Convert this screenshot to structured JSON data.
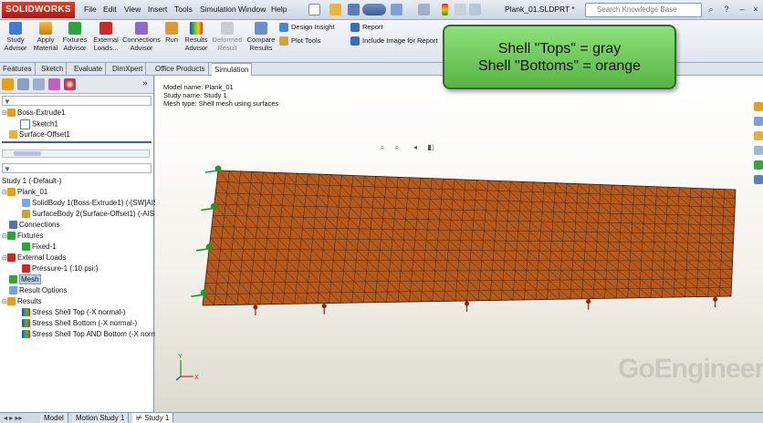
{
  "app": {
    "logo_text": "SOLIDWORKS",
    "document_title": "Plank_01.SLDPRT *"
  },
  "menu": [
    "File",
    "Edit",
    "View",
    "Insert",
    "Tools",
    "Simulation",
    "Window",
    "Help"
  ],
  "search": {
    "placeholder": "Search Knowledge Base"
  },
  "ribbon": {
    "study_advisor": "Study\nAdvisor",
    "apply_material": "Apply\nMaterial",
    "fixtures_advisor": "Fixtures\nAdvisor",
    "external_loads": "External\nLoads...",
    "connections_advisor": "Connections\nAdvisor",
    "run": "Run",
    "results_advisor": "Results\nAdvisor",
    "deformed_result": "Deformed\nResult",
    "compare_results": "Compare\nResults",
    "design_insight": "Design Insight",
    "plot_tools": "Plot Tools",
    "report": "Report",
    "include_image": "Include Image for Report"
  },
  "command_tabs": [
    "Features",
    "Sketch",
    "Evaluate",
    "DimXpert",
    "Office Products",
    "Simulation"
  ],
  "feature_tree": {
    "items": [
      "Boss-Extrude1",
      "Sketch1",
      "Surface-Offset1"
    ]
  },
  "study_tree": {
    "root": "Study 1 (-Default-)",
    "part": "Plank_01",
    "solid_body": "SolidBody 1(Boss-Extrude1) (-[SW]AIS",
    "surface_body": "SurfaceBody 2(Surface-Offset1) (-AISI",
    "connections": "Connections",
    "fixtures": "Fixtures",
    "fixed": "Fixed-1",
    "external_loads": "External Loads",
    "pressure": "Pressure-1 (:10 psi:)",
    "mesh": "Mesh",
    "result_options": "Result Options",
    "results": "Results",
    "result_1": "Stress Shell Top (-X normal-)",
    "result_2": "Stress Shell Bottom (-X normal-)",
    "result_3": "Stress Shell Top AND Bottom (-X norm"
  },
  "viewport": {
    "model_name": "Model name: Plank_01",
    "study_name": "Study name: Study 1",
    "mesh_type": "Mesh type: Shell mesh using surfaces",
    "callout_line1": "Shell \"Tops\" = gray",
    "callout_line2": "Shell \"Bottoms\" = orange",
    "watermark": "GoEngineer",
    "triad_x": "X",
    "triad_y": "Y",
    "mesh_color": "#b55a1e",
    "mesh_line_color": "#3b1a08",
    "fixture_color": "#1e9b2a",
    "pressure_color": "#9a1c1c"
  },
  "bottom_tabs": [
    "Model",
    "Motion Study 1",
    "Study 1"
  ]
}
